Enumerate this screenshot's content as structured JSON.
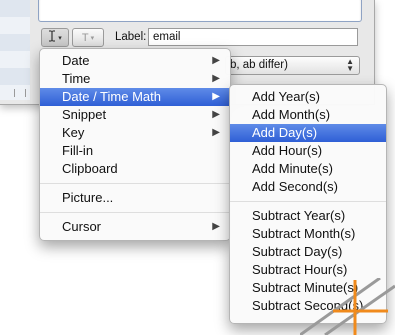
{
  "toolbar": {
    "label_caption": "Label:",
    "label_value": "email",
    "text_button_glyph": "T",
    "dropdown_arrow": "▾"
  },
  "popup_select": {
    "visible_text": "b, ab differ)",
    "stepper_up": "▲",
    "stepper_down": "▼"
  },
  "main_menu": {
    "items": [
      {
        "label": "Date",
        "arrow": "▶"
      },
      {
        "label": "Time",
        "arrow": "▶"
      },
      {
        "label": "Date / Time Math",
        "arrow": "▶"
      },
      {
        "label": "Snippet",
        "arrow": "▶"
      },
      {
        "label": "Key",
        "arrow": "▶"
      },
      {
        "label": "Fill-in"
      },
      {
        "label": "Clipboard"
      },
      {
        "label": "Picture..."
      },
      {
        "label": "Cursor",
        "arrow": "▶"
      }
    ]
  },
  "submenu": {
    "items": [
      {
        "label": "Add Year(s)"
      },
      {
        "label": "Add Month(s)"
      },
      {
        "label": "Add Day(s)"
      },
      {
        "label": "Add Hour(s)"
      },
      {
        "label": "Add Minute(s)"
      },
      {
        "label": "Add Second(s)"
      },
      {
        "label": "Subtract Year(s)"
      },
      {
        "label": "Subtract Month(s)"
      },
      {
        "label": "Subtract Day(s)"
      },
      {
        "label": "Subtract Hour(s)"
      },
      {
        "label": "Subtract Minute(s)"
      },
      {
        "label": "Subtract Second(s)"
      }
    ]
  },
  "colors": {
    "highlight": "#3a6be0",
    "accent_orange": "#f08a1c"
  }
}
